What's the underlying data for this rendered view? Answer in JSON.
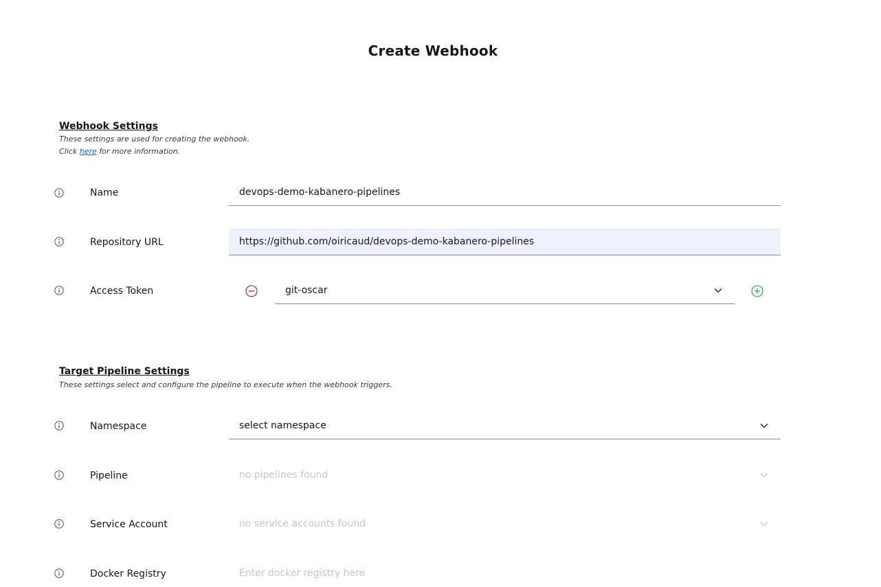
{
  "page": {
    "title": "Create Webhook"
  },
  "webhook_settings": {
    "title": "Webhook Settings",
    "desc_line1": "These settings are used for creating the webhook.",
    "desc_click": "Click",
    "desc_link": "here",
    "desc_rest": "for more information.",
    "fields": {
      "name": {
        "label": "Name",
        "value": "devops-demo-kabanero-pipelines"
      },
      "repo_url": {
        "label": "Repository URL",
        "value": "https://github.com/oiricaud/devops-demo-kabanero-pipelines"
      },
      "access_token": {
        "label": "Access Token",
        "value": "git-oscar"
      }
    }
  },
  "pipeline_settings": {
    "title": "Target Pipeline Settings",
    "desc": "These settings select and configure the pipeline to execute when the webhook triggers.",
    "fields": {
      "namespace": {
        "label": "Namespace",
        "value": "select namespace"
      },
      "pipeline": {
        "label": "Pipeline",
        "value": "no pipelines found"
      },
      "service_account": {
        "label": "Service Account",
        "value": "no service accounts found"
      },
      "docker_registry": {
        "label": "Docker Registry",
        "placeholder": "Enter docker registry here"
      }
    }
  },
  "icons": {
    "info": "information-icon",
    "remove": "minus-circle-icon",
    "add": "plus-circle-icon",
    "dropdown": "chevron-down-icon"
  },
  "colors": {
    "remove": "#a2191f",
    "add": "#24a148",
    "highlight_field": "#edf2fc",
    "link": "#0f62fe"
  }
}
